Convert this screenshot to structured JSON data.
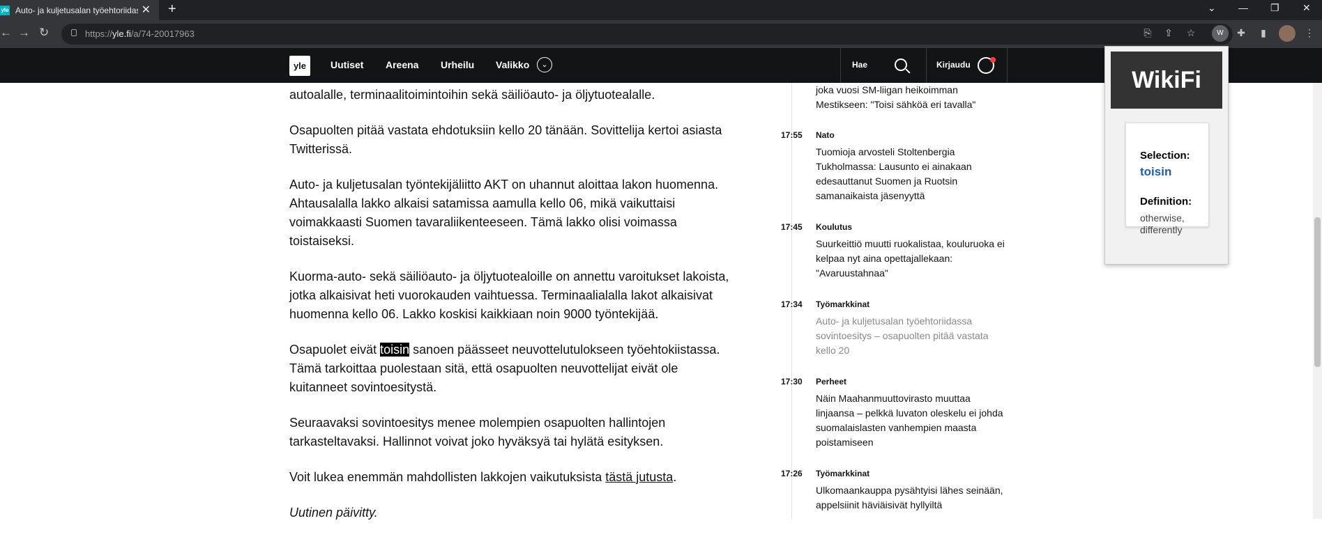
{
  "browser": {
    "tab_title": "Auto- ja kuljetusalan työehtoriidassa",
    "tab_favicon": "yle",
    "url_prefix": "https://",
    "url_host": "yle.fi",
    "url_path": "/a/74-20017963",
    "extension_badge": "W",
    "icons": [
      "back-icon",
      "forward-icon",
      "reload-icon",
      "lock-icon",
      "translate-icon",
      "share-icon",
      "star-icon",
      "puzzle-icon",
      "sidebar-icon",
      "profile-avatar-icon",
      "menu-icon"
    ]
  },
  "header": {
    "logo": "yle",
    "nav": [
      "Uutiset",
      "Areena",
      "Urheilu",
      "Valikko"
    ],
    "search_label": "Hae",
    "login_label": "Kirjaudu"
  },
  "article": {
    "paragraphs": [
      "autoalalle, terminaalitoimintoihin sekä säiliöauto- ja öljytuotealalle.",
      "Osapuolten pitää vastata ehdotuksiin kello 20 tänään. Sovittelija kertoi asiasta Twitterissä.",
      "Auto- ja kuljetusalan työntekijäliitto AKT on uhannut aloittaa lakon huomenna. Ahtausalalla lakko alkaisi satamissa aamulla kello 06, mikä vaikuttaisi voimakkaasti Suomen tavaraliikenteeseen. Tämä lakko olisi voimassa toistaiseksi.",
      "Kuorma-auto- sekä säiliöauto- ja öljytuotealoille on annettu varoitukset lakoista, jotka alkaisivat heti vuorokauden vaihtuessa. Terminaalialalla lakot alkaisivat huomenna kello 06. Lakko koskisi kaikkiaan noin 9000 työntekijää."
    ],
    "p5_before": "Osapuolet eivät ",
    "p5_highlight": "toisin",
    "p5_after": " sanoen päässeet neuvottelutulokseen työehtokiistassa. Tämä tarkoittaa puolestaan sitä, että osapuolten neuvottelijat eivät ole kuitanneet sovintoesitystä.",
    "p6": "Seuraavaksi sovintoesitys menee molempien osapuolten hallintojen tarkasteltavaksi. Hallinnot voivat joko hyväksyä tai hylätä esityksen.",
    "p7_before": "Voit lukea enemmän mahdollisten lakkojen vaikutuksista ",
    "p7_link": "tästä jutusta",
    "p7_after": ".",
    "updated": "Uutinen päivitty."
  },
  "feed": {
    "top_fragment": "joka vuosi SM-liigan heikoimman Mestikseen: \"Toisi sähköä eri tavalla\"",
    "items": [
      {
        "time": "17:55",
        "category": "Nato",
        "title": "Tuomioja arvosteli Stoltenbergia Tukholmassa: Lausunto ei ainakaan edesauttanut Suomen ja Ruotsin samanaikaista jäsenyyttä",
        "visited": false
      },
      {
        "time": "17:45",
        "category": "Koulutus",
        "title": "Suurkeittiö muutti ruokalistaa, kouluruoka ei kelpaa nyt aina opettajallekaan: \"Avaruustahnaa\"",
        "visited": false
      },
      {
        "time": "17:34",
        "category": "Työmarkkinat",
        "title": "Auto- ja kuljetusalan työehtoriidassa sovintoesitys – osapuolten pitää vastata kello 20",
        "visited": true
      },
      {
        "time": "17:30",
        "category": "Perheet",
        "title": "Näin Maahanmuuttovirasto muuttaa linjaansa – pelkkä luvaton oleskelu ei johda suomalaislasten vanhempien maasta poistamiseen",
        "visited": false
      },
      {
        "time": "17:26",
        "category": "Työmarkkinat",
        "title": "Ulkomaankauppa pysähtyisi lähes seinään, appelsiinit häviäisivät hyllyiltä",
        "visited": false
      }
    ]
  },
  "wikifi": {
    "title": "WikiFi",
    "selection_label": "Selection:",
    "selection": "toisin",
    "definition_label": "Definition:",
    "definition": "otherwise, differently"
  }
}
